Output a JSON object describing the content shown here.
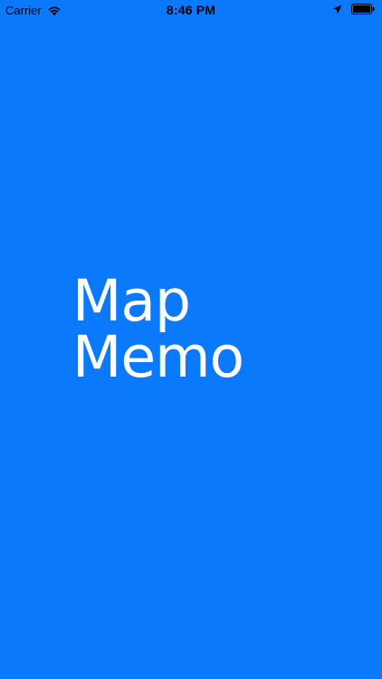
{
  "status_bar": {
    "carrier": "Carrier",
    "time": "8:46 PM",
    "icons": {
      "wifi": "wifi-icon",
      "location": "location-arrow-icon",
      "battery": "battery-icon"
    }
  },
  "splash": {
    "title_line_1": "Map",
    "title_line_2": "Memo"
  },
  "colors": {
    "background": "#0a79fb",
    "title": "#ffffff",
    "status_text": "#000000"
  }
}
